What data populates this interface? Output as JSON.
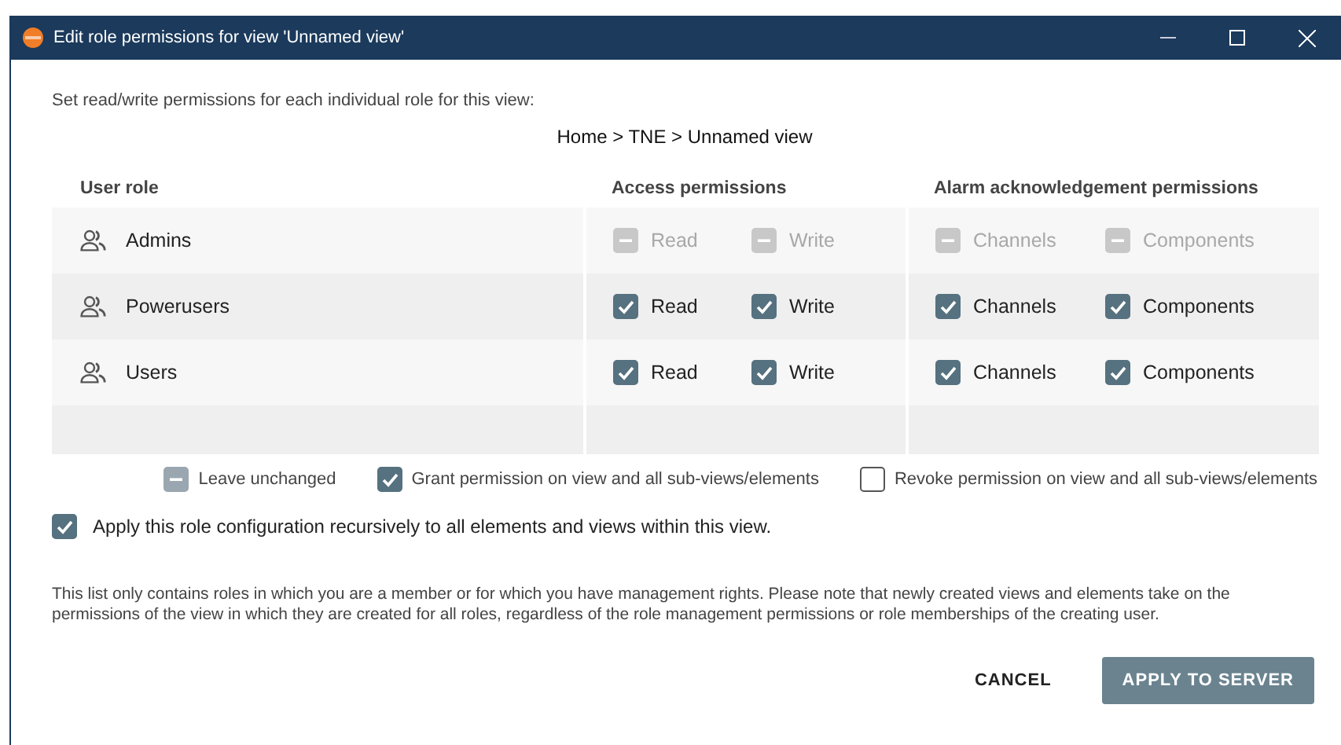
{
  "window": {
    "title": "Edit role permissions for view 'Unnamed view'"
  },
  "intro": "Set read/write permissions for each individual role for this view:",
  "breadcrumb": "Home > TNE > Unnamed view",
  "columns": [
    "User role",
    "Access permissions",
    "Alarm acknowledgement permissions"
  ],
  "roles": [
    {
      "name": "Admins",
      "disabled": true,
      "permissions": [
        {
          "label": "Read",
          "indeterminate": true
        },
        {
          "label": "Write",
          "indeterminate": true
        },
        {
          "label": "Channels",
          "indeterminate": true
        },
        {
          "label": "Components",
          "indeterminate": true
        }
      ]
    },
    {
      "name": "Powerusers",
      "disabled": false,
      "permissions": [
        {
          "label": "Read",
          "checked": true,
          "indeterminate": false
        },
        {
          "label": "Write",
          "checked": true,
          "indeterminate": false
        },
        {
          "label": "Channels",
          "checked": true,
          "indeterminate": false
        },
        {
          "label": "Components",
          "checked": true,
          "indeterminate": false
        }
      ]
    },
    {
      "name": "Users",
      "disabled": false,
      "permissions": [
        {
          "label": "Read",
          "checked": true,
          "indeterminate": false
        },
        {
          "label": "Write",
          "checked": true,
          "indeterminate": false
        },
        {
          "label": "Channels",
          "checked": true,
          "indeterminate": false
        },
        {
          "label": "Components",
          "checked": true,
          "indeterminate": false
        }
      ]
    }
  ],
  "legend": [
    {
      "label": "Leave unchanged",
      "indeterminate": true
    },
    {
      "label": "Grant permission on view and all sub-views/elements",
      "checked": true,
      "indeterminate": false
    },
    {
      "label": "Revoke permission on view and all sub-views/elements",
      "checked": false,
      "indeterminate": false
    }
  ],
  "recursive": {
    "label": "Apply this role configuration recursively to all elements and views within this view.",
    "checked": true
  },
  "note": "This list only contains roles in which you are a member or for which you have management rights. Please note that newly created views and elements take on the permissions of the view in which they are created for all roles, regardless of the role management permissions or role memberships of the creating user.",
  "buttons": [
    {
      "label": "CANCEL",
      "kind": "flat"
    },
    {
      "label": "APPLY TO SERVER",
      "kind": "primary"
    }
  ]
}
